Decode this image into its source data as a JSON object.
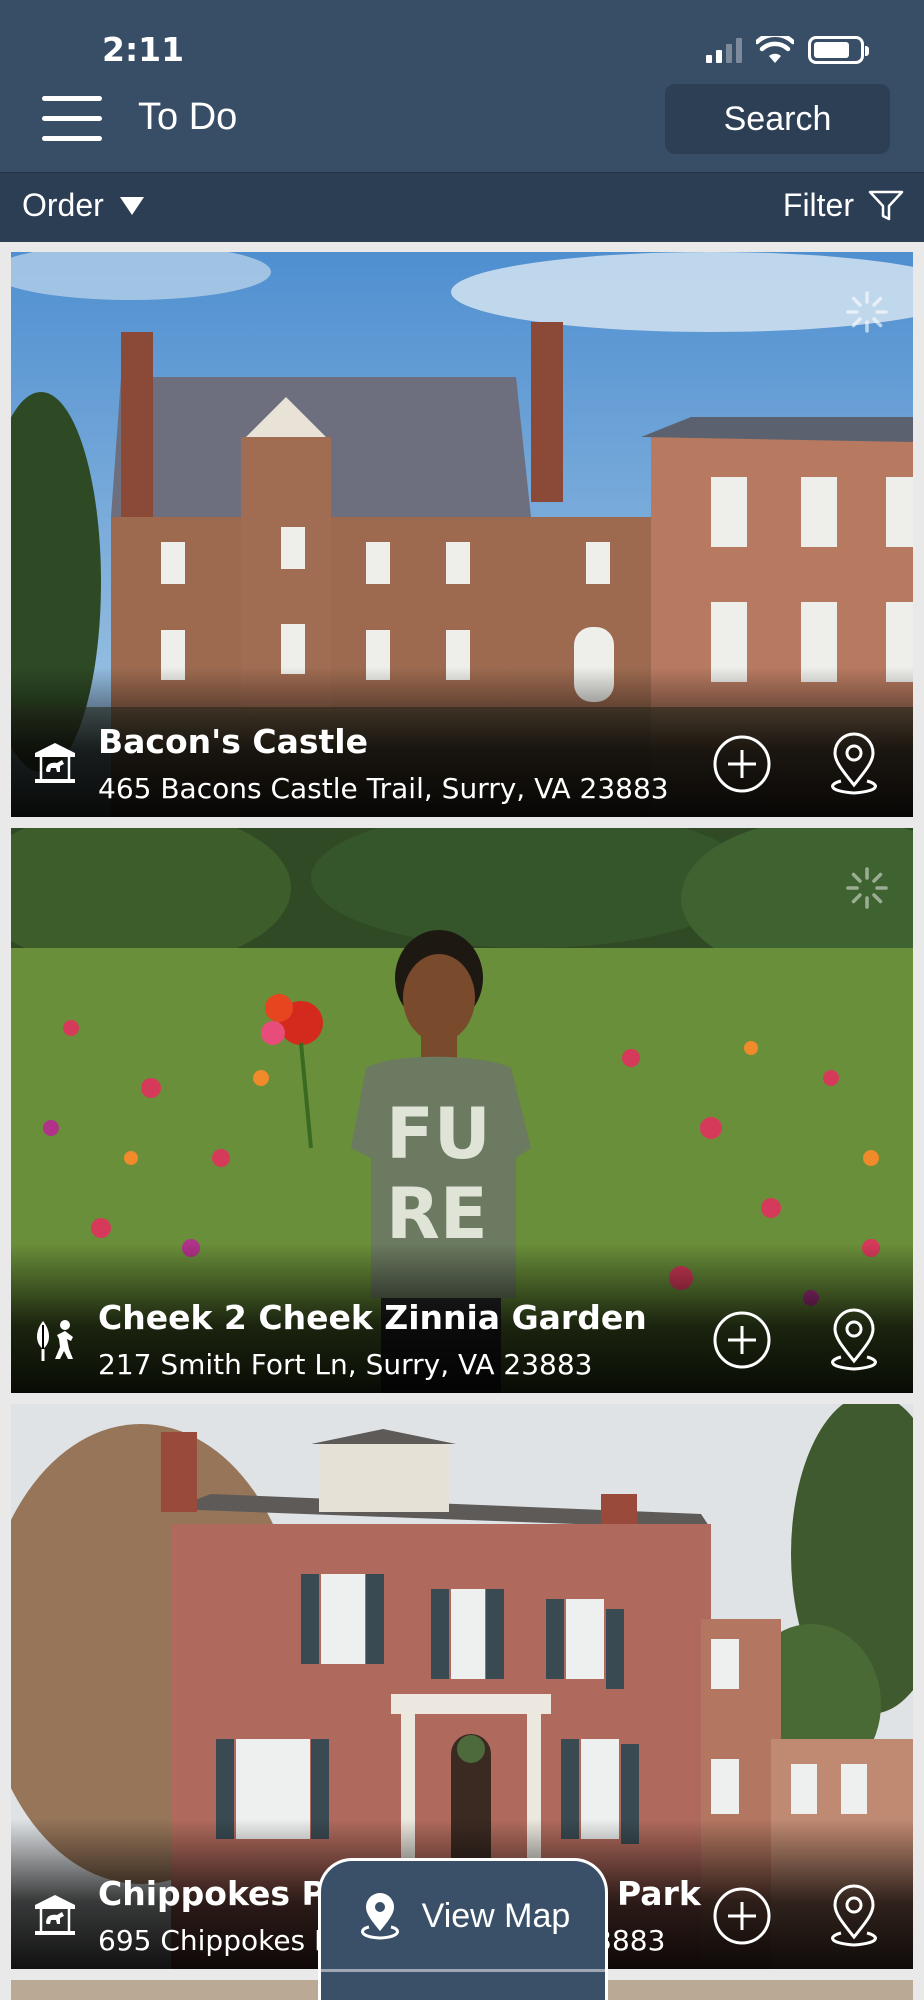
{
  "status_bar": {
    "time": "2:11"
  },
  "header": {
    "title": "To Do",
    "search_label": "Search"
  },
  "toolbar": {
    "order_label": "Order",
    "filter_label": "Filter"
  },
  "cards": [
    {
      "name": "Bacon's Castle",
      "address": "465 Bacons Castle Trail, Surry, VA 23883",
      "category_icon": "carousel-icon"
    },
    {
      "name": "Cheek 2 Cheek Zinnia Garden",
      "address": "217 Smith Fort Ln, Surry, VA 23883",
      "category_icon": "farm-produce-icon"
    },
    {
      "name": "Chippokes Plantation State Park",
      "address": "695 Chippokes Park Rd, Surry, VA 23883",
      "category_icon": "carousel-icon"
    }
  ],
  "view_map": {
    "label": "View Map"
  },
  "colors": {
    "header_bg": "#384d66",
    "subbar_bg": "#2c3e54",
    "search_bg": "#2d3f55",
    "map_button_bg": "#3a5069"
  }
}
